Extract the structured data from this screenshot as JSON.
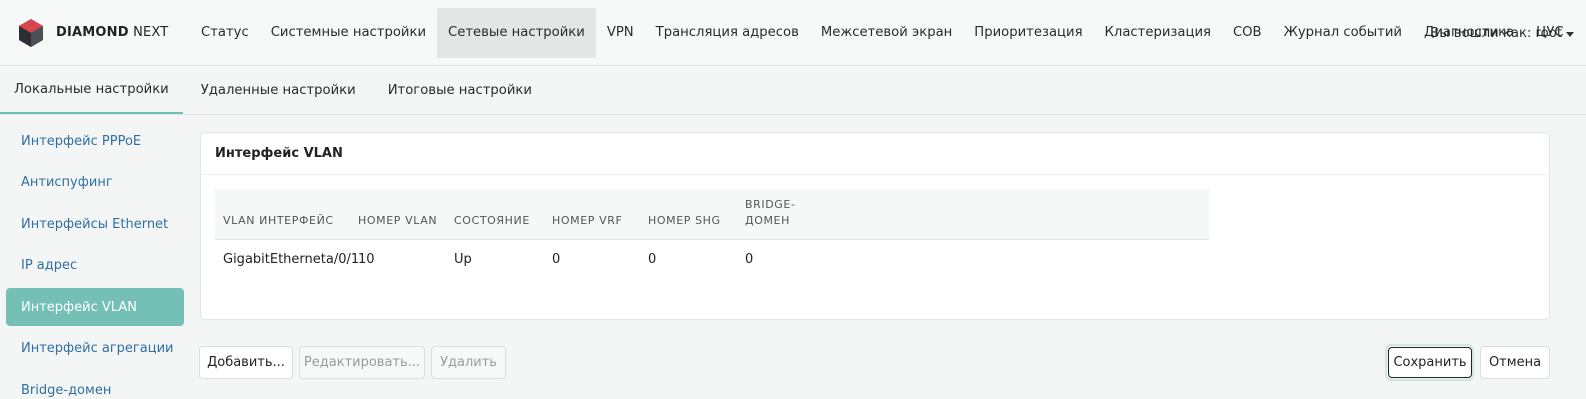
{
  "brand": {
    "name_bold": "DIAMOND",
    "name_rest": " NEXT"
  },
  "colors": {
    "accent": "#74c0b7",
    "link": "#2f6fa3",
    "logo_red": "#d8454f",
    "logo_dark": "#3b3f47"
  },
  "topnav": {
    "items": [
      {
        "label": "Статус"
      },
      {
        "label": "Системные настройки"
      },
      {
        "label": "Сетевые настройки",
        "active": true
      },
      {
        "label": "VPN"
      },
      {
        "label": "Трансляция адресов"
      },
      {
        "label": "Межсетевой экран"
      },
      {
        "label": "Приоритезация"
      },
      {
        "label": "Кластеризация"
      },
      {
        "label": "СОВ"
      },
      {
        "label": "Журнал событий"
      },
      {
        "label": "Диагностика"
      },
      {
        "label": "ЦУС"
      }
    ],
    "user_label": "Вы вошли как: root"
  },
  "subtabs": {
    "items": [
      {
        "label": "Локальные настройки",
        "active": true
      },
      {
        "label": "Удаленные настройки"
      },
      {
        "label": "Итоговые настройки"
      }
    ]
  },
  "sidebar": {
    "items": [
      {
        "label": "Интерфейс PPPoE"
      },
      {
        "label": "Антиспуфинг"
      },
      {
        "label": "Интерфейсы Ethernet"
      },
      {
        "label": "IP адрес"
      },
      {
        "label": "Интерфейс VLAN",
        "active": true
      },
      {
        "label": "Интерфейс агрегации"
      },
      {
        "label": "Bridge-домен"
      }
    ]
  },
  "card": {
    "title": "Интерфейс VLAN",
    "table": {
      "headers": [
        "VLAN ИНТЕРФЕЙС",
        "НОМЕР VLAN",
        "СОСТОЯНИЕ",
        "НОМЕР VRF",
        "НОМЕР SHG",
        "BRIDGE-\nДОМЕН"
      ],
      "rows": [
        [
          "GigabitEtherneta/0/1",
          "10",
          "Up",
          "0",
          "0",
          "0"
        ]
      ]
    }
  },
  "actions": {
    "add": "Добавить...",
    "edit": "Редактировать...",
    "delete": "Удалить",
    "save": "Сохранить",
    "cancel": "Отмена"
  },
  "icons": {
    "logo": "diamond-logo-icon",
    "user_caret": "chevron-down-icon"
  }
}
